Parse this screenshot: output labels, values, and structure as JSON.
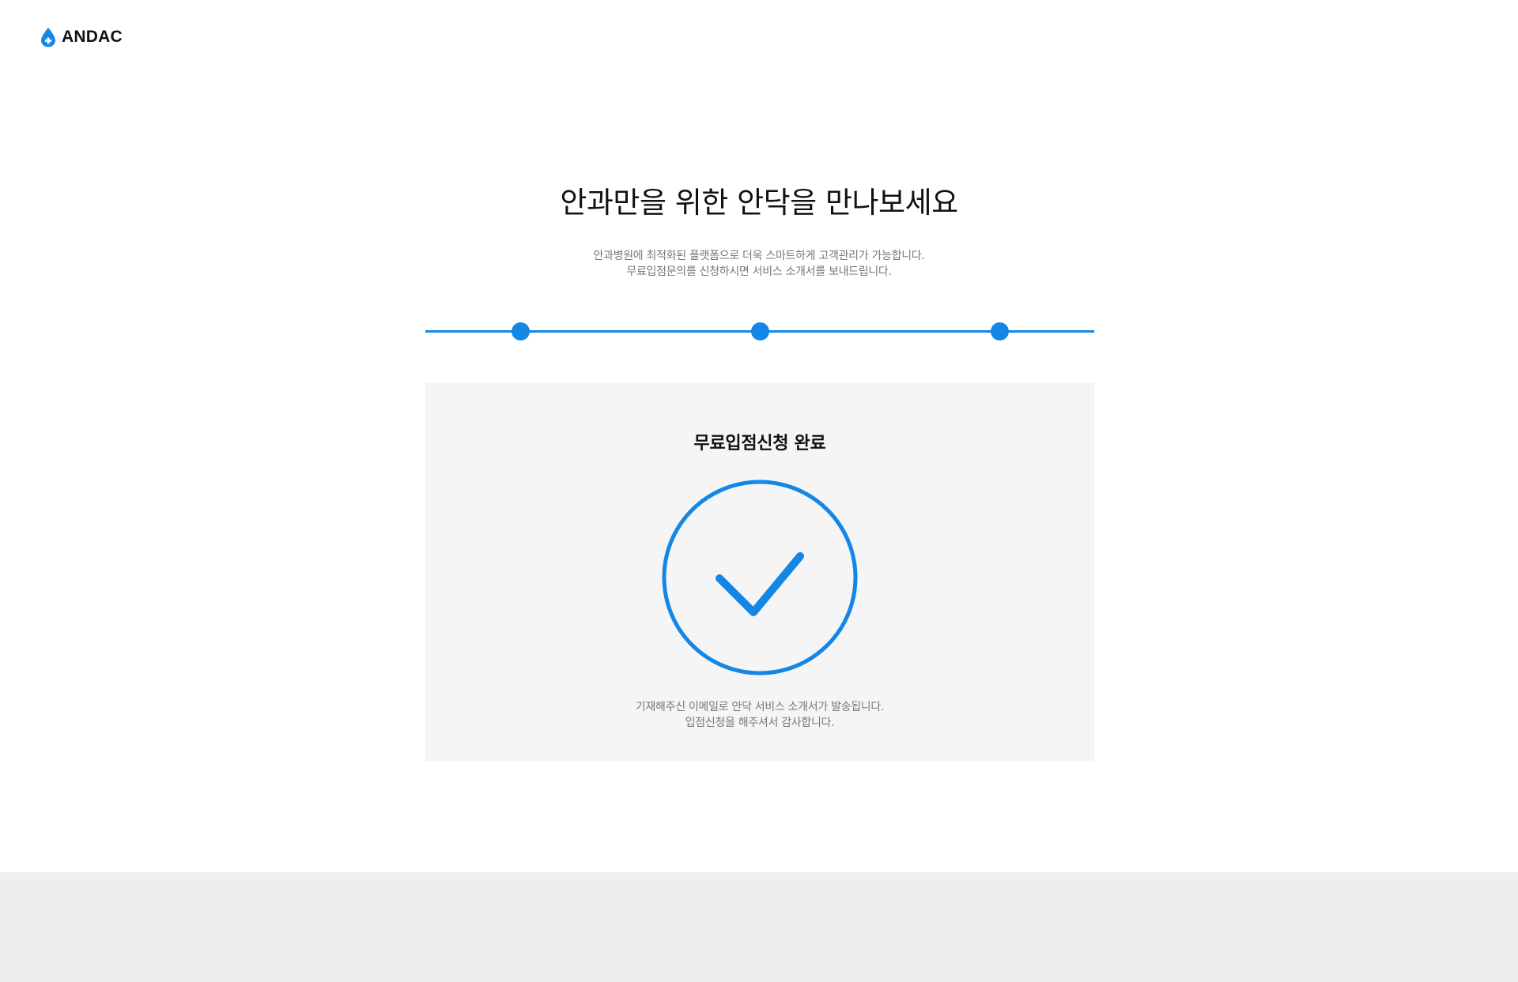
{
  "brand": {
    "name": "ANDAC",
    "icon": "water-drop-plus-icon",
    "accent_color": "#1487e6"
  },
  "hero": {
    "title": "안과만을 위한 안닥을 만나보세요",
    "desc_line1": "안과병원에 최적화된 플랫폼으로 더욱 스마트하게 고객관리가 가능합니다.",
    "desc_line2": "무료입점문의를 신청하시면 서비스 소개서를 보내드립니다."
  },
  "steps": {
    "total": 3,
    "completed": 3
  },
  "result": {
    "title": "무료입점신청 완료",
    "icon": "check-circle-icon",
    "desc_line1": "기재해주신 이메일로 안닥 서비스 소개서가 발송됩니다.",
    "desc_line2": "입점신청을 해주셔서 감사합니다."
  },
  "colors": {
    "card_bg": "#f5f5f5",
    "footer_bg": "#eeeeee",
    "muted_text": "#777777"
  }
}
